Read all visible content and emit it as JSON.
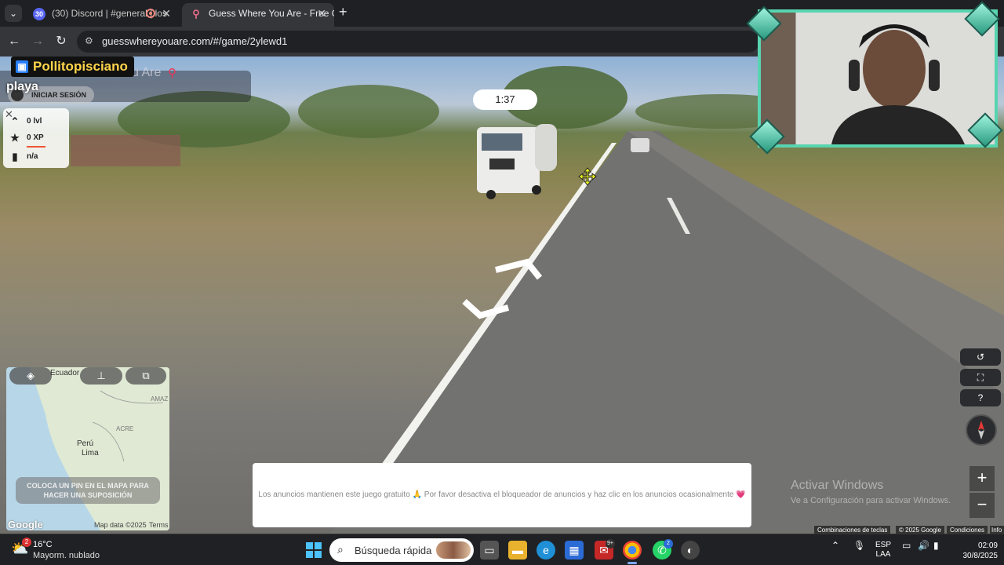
{
  "browser": {
    "tabs": [
      {
        "title": "(30) Discord | #general | los",
        "badge": "30",
        "active": false
      },
      {
        "title": "Guess Where You Are - Free Ge",
        "active": true
      }
    ],
    "url": "guesswhereyouare.com/#/game/2ylewd1"
  },
  "overlay": {
    "streamer_name": "Pollitopisciano",
    "logo_partial": "u Are",
    "word": "playa"
  },
  "game": {
    "login_label": "INICIAR SESIÓN",
    "stats": {
      "level": "0 lvl",
      "xp": "0 XP",
      "rank": "n/a"
    },
    "timer": "1:37",
    "map": {
      "labels": {
        "country1": "Ecuador",
        "country2": "Perú",
        "city": "Lima",
        "region1": "ACRE",
        "region2": "AMAZ"
      },
      "hint": "COLOCA UN PIN EN EL MAPA PARA HACER UNA SUPOSICIÓN",
      "map_data": "Map data ©2025",
      "terms": "Terms",
      "google": "Google"
    },
    "ad_text": "Los anuncios mantienen este juego gratuito 🙏 Por favor desactiva el bloqueador de anuncios y haz clic en los anuncios ocasionalmente 💗"
  },
  "streetview": {
    "zoom_in": "+",
    "zoom_out": "−",
    "attribution": {
      "shortcuts": "Combinaciones de teclas",
      "copyright": "© 2025 Google",
      "conditions": "Condiciones",
      "info": "Info"
    }
  },
  "windows_watermark": {
    "title": "Activar Windows",
    "subtitle": "Ve a Configuración para activar Windows."
  },
  "taskbar": {
    "weather": {
      "temp": "16°C",
      "desc": "Mayorm. nublado",
      "badge": "2"
    },
    "search_placeholder": "Búsqueda rápida",
    "lang": {
      "line1": "ESP",
      "line2": "LAA"
    },
    "time": "02:09",
    "date": "30/8/2025",
    "gmail_badge": "9+",
    "whatsapp_badge": "2"
  }
}
